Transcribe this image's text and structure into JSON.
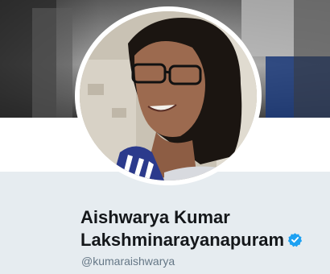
{
  "profile": {
    "name_line1": "Aishwarya Kumar",
    "name_line2": "Lakshminarayanapuram",
    "handle": "@kumaraishwarya",
    "verified": true
  },
  "icons": {
    "verified": "verified-badge-icon"
  },
  "colors": {
    "background": "#e6ecf0",
    "name_text": "#14171a",
    "handle_text": "#657786",
    "verified_badge": "#1da1f2"
  }
}
